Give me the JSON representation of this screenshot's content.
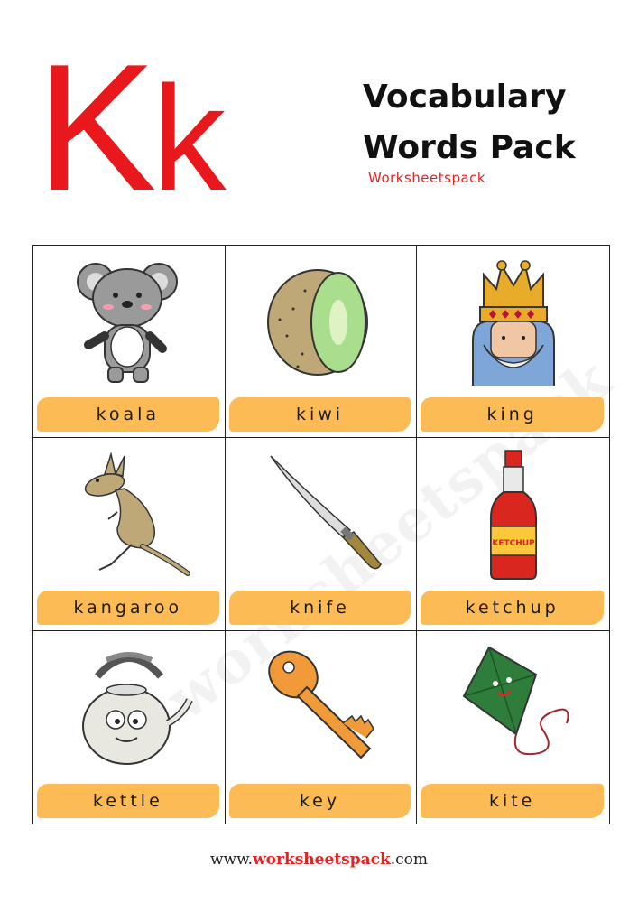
{
  "header": {
    "letter_upper": "K",
    "letter_lower": "k",
    "title_line1": "Vocabulary",
    "title_line2": "Words Pack",
    "brand": "Worksheetspack"
  },
  "colors": {
    "letter": "#e8181c",
    "label_bg": "#fdbb55",
    "accent": "#e02525"
  },
  "cards": [
    {
      "word": "koala",
      "icon": "koala-icon"
    },
    {
      "word": "kiwi",
      "icon": "kiwi-icon"
    },
    {
      "word": "king",
      "icon": "king-icon"
    },
    {
      "word": "kangaroo",
      "icon": "kangaroo-icon"
    },
    {
      "word": "knife",
      "icon": "knife-icon"
    },
    {
      "word": "ketchup",
      "icon": "ketchup-icon"
    },
    {
      "word": "kettle",
      "icon": "kettle-icon"
    },
    {
      "word": "key",
      "icon": "key-icon"
    },
    {
      "word": "kite",
      "icon": "kite-icon"
    }
  ],
  "ketchup_label": "KETCHUP",
  "watermark": "worksheetspack",
  "footer": {
    "prefix": "www.",
    "accent": "worksheetspack",
    "suffix": ".com"
  }
}
